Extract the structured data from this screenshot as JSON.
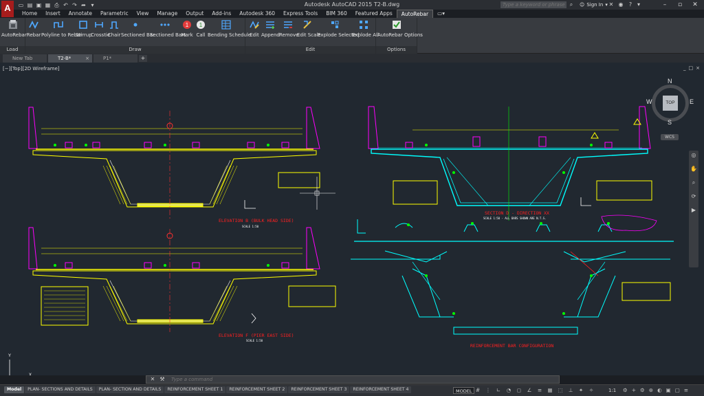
{
  "app": {
    "title": "Autodesk AutoCAD 2015    T2-B.dwg",
    "logo_letter": "A",
    "search_placeholder": "Type a keyword or phrase",
    "signin_label": "Sign In"
  },
  "ribbon_tabs": [
    "Home",
    "Insert",
    "Annotate",
    "Parametric",
    "View",
    "Manage",
    "Output",
    "Add-ins",
    "Autodesk 360",
    "Express Tools",
    "BIM 360",
    "Featured Apps",
    "AutoRebar"
  ],
  "ribbon_active_tab": "AutoRebar",
  "ribbon_groups": {
    "load": {
      "title": "Load",
      "buttons": [
        "AutoRebar"
      ]
    },
    "draw": {
      "title": "Draw",
      "buttons": [
        "Rebar",
        "Polyline to Rebar",
        "Stirrup",
        "Crosstie",
        "Chair",
        "Sectioned Bar",
        "Sectioned Bars",
        "Mark",
        "Call",
        "Bending Schedule"
      ]
    },
    "edit": {
      "title": "Edit",
      "buttons": [
        "Edit",
        "Append",
        "Remove",
        "Edit Scale",
        "Explode Selected",
        "Explode All"
      ]
    },
    "options": {
      "title": "Options",
      "buttons": [
        "AutoRebar Options"
      ]
    }
  },
  "doc_tabs": [
    {
      "label": "New Tab",
      "active": false
    },
    {
      "label": "T2-B*",
      "active": true
    },
    {
      "label": "P1*",
      "active": false
    }
  ],
  "viewport": {
    "label": "[−][Top][2D Wireframe]",
    "controls": [
      "_",
      "□",
      "×"
    ]
  },
  "viewcube": {
    "top": "TOP",
    "north": "N",
    "south": "S",
    "east": "E",
    "west": "W",
    "wcs": "WCS"
  },
  "drawing_labels": {
    "elev_b": "ELEVATION B (BULK HEAD SIDE)",
    "elev_f": "ELEVATION F (PIER EAST SIDE)",
    "section_d": "SECTION D - DIRECTION XX",
    "reinf": "REINFORCEMENT BAR CONFIGURATION",
    "scale": "SCALE 1:50",
    "section_scale": "SCALE 1:50 - ALL BARS SHOWN ARE N.T.S."
  },
  "command": {
    "placeholder": "Type a command"
  },
  "layout_tabs": [
    "Model",
    "PLAN- SECTIONS AND DETAILS",
    "PLAN- SECTION  AND DETAILS",
    "REINFORCEMENT SHEET 1",
    "REINFORCEMENT SHEET 2",
    "REINFORCEMENT SHEET 3",
    "REINFORCEMENT SHEET 4"
  ],
  "status": {
    "model": "MODEL",
    "scale": "1:1"
  },
  "colors": {
    "ribbon_bg": "#383b40",
    "canvas_bg": "#212830",
    "cad_yellow": "#ffff00",
    "cad_magenta": "#ff00ff",
    "cad_cyan": "#00ffff",
    "cad_red": "#ff2020",
    "cad_green": "#00ff00"
  }
}
